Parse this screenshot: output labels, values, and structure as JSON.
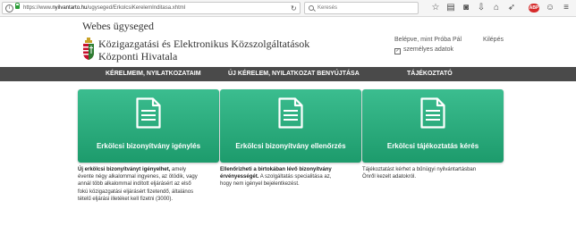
{
  "browser": {
    "url_prefix": "https://www.",
    "url_domain": "nyilvantarto.hu",
    "url_path": "/ugyseged/ErkolcsiKerelemInditasa.xhtml",
    "search_placeholder": "Keresés",
    "info_glyph": "i"
  },
  "header": {
    "small_title": "Webes ügyseged",
    "org_line1": "Közigazgatási és Elektronikus Közszolgáltatások",
    "org_line2": "Központi Hivatala",
    "user_name": "Belépve, mint Próba Pál",
    "logout": "Kilépés",
    "user_data": "személyes adatok",
    "check_glyph": "✓"
  },
  "nav": {
    "items": [
      {
        "label": "KÉRELMEIM, NYILATKOZATAIM"
      },
      {
        "label": "ÚJ KÉRELEM, NYILATKOZAT BENYÚJTÁSA"
      },
      {
        "label": "TÁJÉKOZTATÓ"
      }
    ]
  },
  "cards": [
    {
      "label": "Erkölcsi bizonyítvány igénylés",
      "icon": "document-icon",
      "desc_bold": "Új erkölcsi bizonyítványt igényelhet,",
      "desc_line1_rest": " amely",
      "desc_lines": [
        "évente négy alkalommal ingyenes, az ötödik, vagy",
        "annál több alkalommal indított eljárásért az első",
        "fokú közigazgatási eljárásért fizetendő, általános",
        "tételű eljárási illetéket kell fizetni (3000)."
      ]
    },
    {
      "label": "Erkölcsi bizonyítvány ellenőrzés",
      "icon": "document-icon",
      "desc_bold": "Ellenőrizheti a birtokában lévő bizonyítvány",
      "desc_bold2": "érvényességét.",
      "desc_line2_rest": " A szolgáltatás specialitása az,",
      "desc_lines": [
        "hogy nem igényel bejelentkezést."
      ]
    },
    {
      "label": "Erkölcsi tájékoztatás kérés",
      "icon": "document-icon",
      "desc_lines": [
        "Tájékoztatást kérhet a bűnügyi nyilvántartásban",
        "Önről kezelt adatokról."
      ]
    }
  ],
  "colors": {
    "card_top": "#3bbd8f",
    "card_bottom": "#1d9b6c",
    "nav_bg": "#4a4a4a"
  }
}
